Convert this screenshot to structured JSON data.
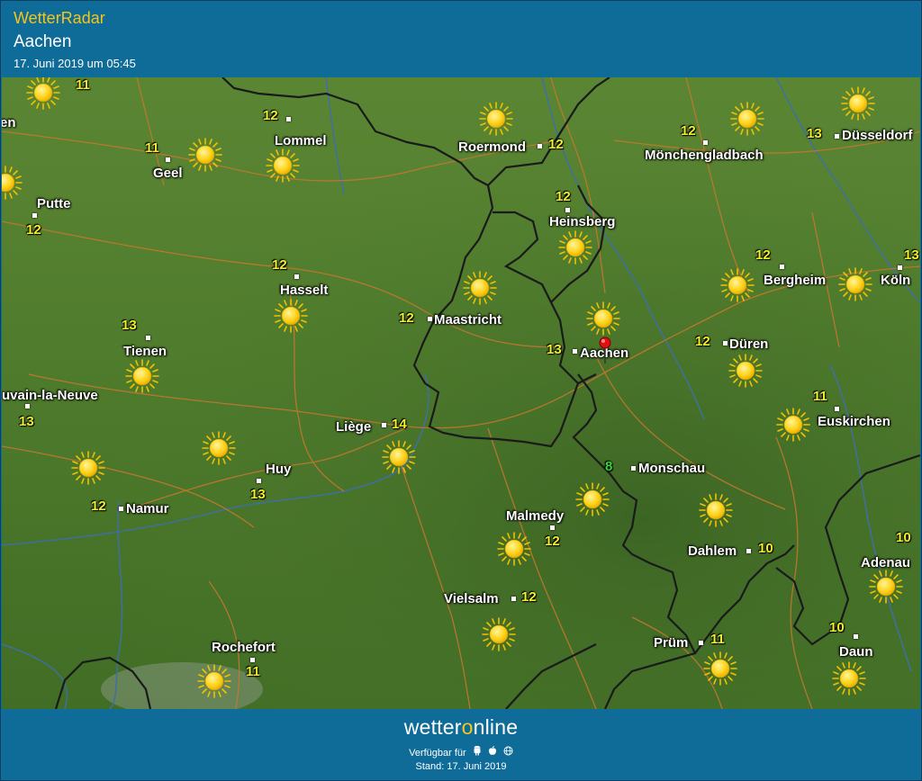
{
  "header": {
    "app_title": "WetterRadar",
    "location": "Aachen",
    "timestamp": "17. Juni 2019 um 05:45"
  },
  "colors": {
    "header_bg": "#0f6c99",
    "title_yellow": "#f5c518",
    "map_green": "#4e7a2c",
    "border_black": "#1a1a1a",
    "road_orange": "#c8782e",
    "river_blue": "#3f6fa6",
    "temp_yellow": "#f3ee2a",
    "temp_green": "#39d43a",
    "pin_red": "#e01010"
  },
  "map": {
    "places": [
      {
        "name": "Lommel"
      },
      {
        "name": "Roermond"
      },
      {
        "name": "Mönchengladbach"
      },
      {
        "name": "Düsseldorf"
      },
      {
        "name": "Geel"
      },
      {
        "name": "Putte"
      },
      {
        "name": "Heinsberg"
      },
      {
        "name": "Hasselt"
      },
      {
        "name": "Bergheim"
      },
      {
        "name": "Köln"
      },
      {
        "name": "Maastricht"
      },
      {
        "name": "Tienen"
      },
      {
        "name": "Aachen"
      },
      {
        "name": "Düren"
      },
      {
        "name": "Ottignies-Louvain-la-Neuve",
        "display": "uvain-la-Neuve"
      },
      {
        "name": "Euskirchen"
      },
      {
        "name": "Liège"
      },
      {
        "name": "Monschau"
      },
      {
        "name": "Huy"
      },
      {
        "name": "Namur"
      },
      {
        "name": "Malmedy"
      },
      {
        "name": "Dahlem"
      },
      {
        "name": "Adenau"
      },
      {
        "name": "Vielsalm"
      },
      {
        "name": "Prüm"
      },
      {
        "name": "Rochefort"
      },
      {
        "name": "Daun"
      },
      {
        "name": "Mechelen",
        "display": "en"
      }
    ],
    "temperatures": [
      {
        "value": "11"
      },
      {
        "value": "12"
      },
      {
        "value": "12"
      },
      {
        "value": "12"
      },
      {
        "value": "13"
      },
      {
        "value": "11"
      },
      {
        "value": "12"
      },
      {
        "value": "12"
      },
      {
        "value": "12"
      },
      {
        "value": "12"
      },
      {
        "value": "13"
      },
      {
        "value": "12"
      },
      {
        "value": "13"
      },
      {
        "value": "12"
      },
      {
        "value": "13"
      },
      {
        "value": "11"
      },
      {
        "value": "14"
      },
      {
        "value": "8"
      },
      {
        "value": "13"
      },
      {
        "value": "12"
      },
      {
        "value": "12"
      },
      {
        "value": "10"
      },
      {
        "value": "10"
      },
      {
        "value": "12"
      },
      {
        "value": "11"
      },
      {
        "value": "11"
      },
      {
        "value": "10"
      }
    ],
    "weather_icon": "sun-icon",
    "marker_icon": "location-pin-icon"
  },
  "footer": {
    "brand_prefix": "wetter",
    "brand_o": "o",
    "brand_suffix": "nline",
    "available_label": "Verfügbar für",
    "platform_icons": [
      "android-icon",
      "apple-icon",
      "web-icon"
    ],
    "stand": "Stand: 17. Juni 2019"
  }
}
